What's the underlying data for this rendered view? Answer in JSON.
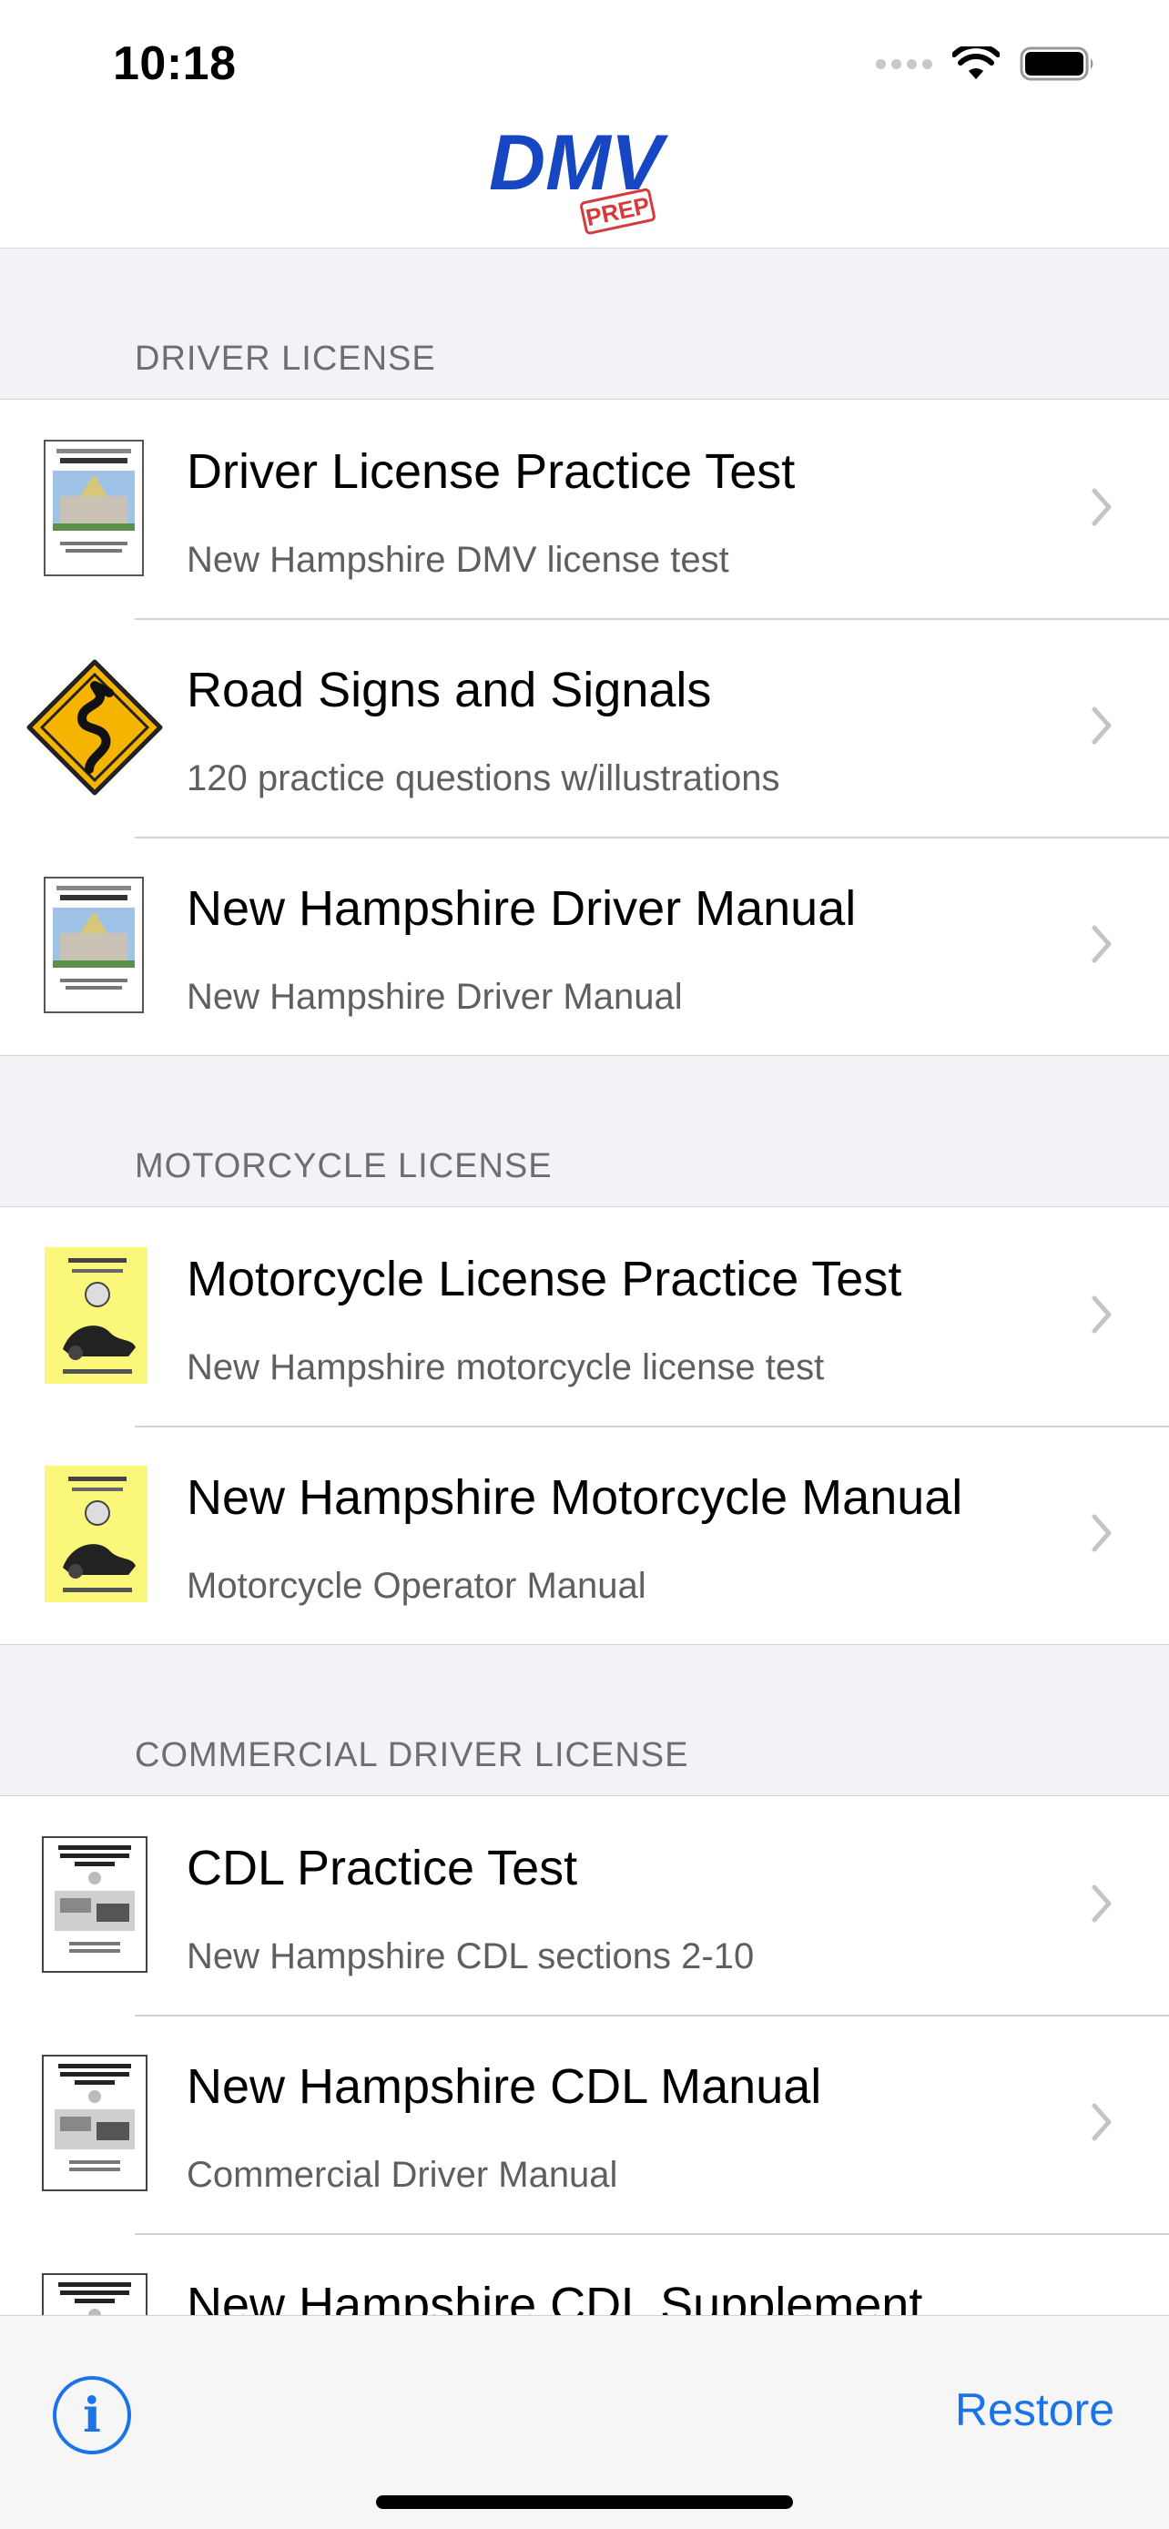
{
  "status_bar": {
    "time": "10:18"
  },
  "header": {
    "logo_text": "DMV",
    "logo_badge": "PREP"
  },
  "sections": [
    {
      "title": "DRIVER LICENSE",
      "items": [
        {
          "title": "Driver License Practice Test",
          "subtitle": "New Hampshire DMV license test",
          "icon": "nh-drivers-manual-cover"
        },
        {
          "title": "Road Signs and Signals",
          "subtitle": "120 practice questions w/illustrations",
          "icon": "winding-road-sign"
        },
        {
          "title": "New Hampshire Driver Manual",
          "subtitle": "New Hampshire Driver Manual",
          "icon": "nh-drivers-manual-cover"
        }
      ]
    },
    {
      "title": "MOTORCYCLE LICENSE",
      "items": [
        {
          "title": "Motorcycle License Practice Test",
          "subtitle": "New Hampshire motorcycle license test",
          "icon": "motorcycle-manual-cover"
        },
        {
          "title": "New Hampshire Motorcycle Manual",
          "subtitle": "Motorcycle Operator Manual",
          "icon": "motorcycle-manual-cover"
        }
      ]
    },
    {
      "title": "COMMERCIAL DRIVER LICENSE",
      "items": [
        {
          "title": "CDL Practice Test",
          "subtitle": "New Hampshire CDL sections 2-10",
          "icon": "cdl-guide-cover"
        },
        {
          "title": "New Hampshire CDL Manual",
          "subtitle": "Commercial Driver Manual",
          "icon": "cdl-guide-cover"
        },
        {
          "title": "New Hampshire CDL Supplement",
          "subtitle": "",
          "icon": "cdl-guide-cover"
        }
      ]
    }
  ],
  "toolbar": {
    "info_glyph": "i",
    "restore_label": "Restore"
  },
  "colors": {
    "accent": "#1a73e8",
    "logo_blue": "#1746c2",
    "logo_red": "#d63a3a",
    "road_sign_yellow": "#f5b400"
  }
}
